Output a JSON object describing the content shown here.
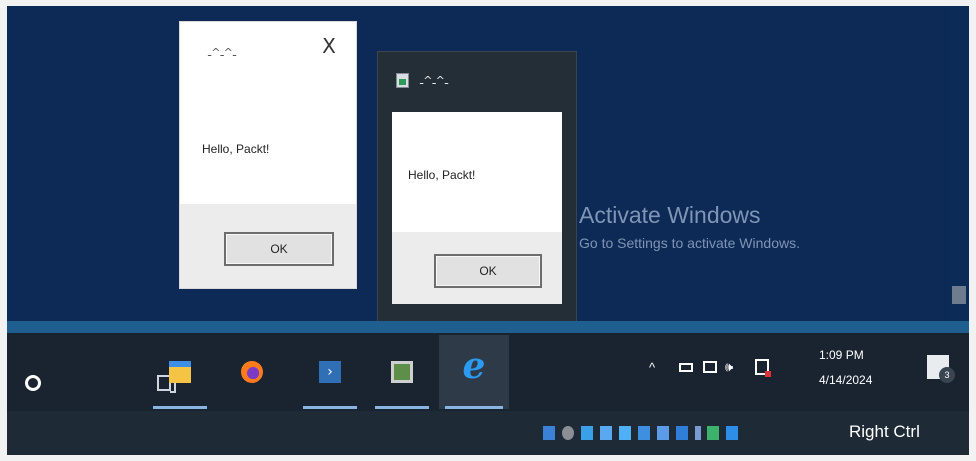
{
  "dialog1": {
    "title": "ـ^ـ^ـ",
    "close_glyph": "X",
    "message": "Hello, Packt!",
    "ok_label": "OK"
  },
  "dialog2": {
    "title": "ـ^ـ^ـ",
    "message": "Hello, Packt!",
    "ok_label": "OK"
  },
  "watermark": {
    "title": "Activate Windows",
    "subtitle": "Go to Settings to activate Windows."
  },
  "taskbar": {
    "pinned": [
      {
        "name": "search",
        "icon": "search-circle-icon"
      },
      {
        "name": "task-view",
        "icon": "task-view-icon"
      },
      {
        "name": "file-explorer",
        "icon": "folder-icon"
      },
      {
        "name": "firefox",
        "icon": "firefox-icon"
      },
      {
        "name": "powershell",
        "icon": "powershell-icon"
      },
      {
        "name": "remote-app",
        "icon": "monitor-icon"
      },
      {
        "name": "internet-explorer",
        "icon": "ie-icon"
      }
    ],
    "tray": {
      "chevron": "^",
      "volume_glyph": "🕪"
    },
    "clock": {
      "time": "1:09 PM",
      "date": "4/14/2024"
    },
    "notification_count": "3"
  },
  "vm_statusbar": {
    "host_key": "Right Ctrl"
  },
  "colors": {
    "desktop": "#0c2a55",
    "taskbar": "#1a2330",
    "accent_strip": "#1e5f8f",
    "watermark": "#7e95b5"
  }
}
